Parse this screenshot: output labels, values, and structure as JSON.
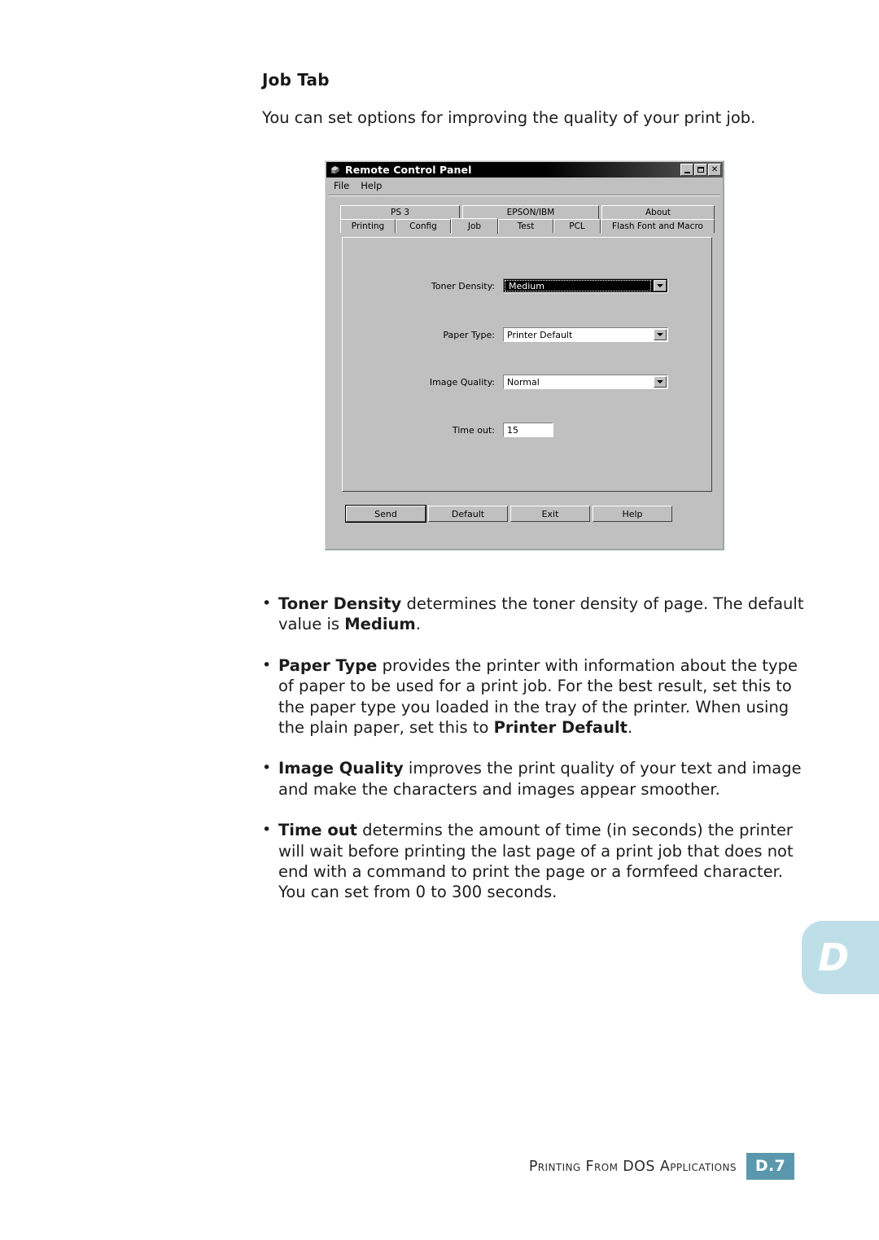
{
  "page": {
    "heading": "Job Tab",
    "intro": "You can set options for improving the quality of your print job.",
    "side_tab_letter": "D"
  },
  "bullets": [
    {
      "term": "Toner Density",
      "rest": " determines the toner density of page. The default value is ",
      "term2": "Medium",
      "tail": "."
    },
    {
      "term": "Paper Type",
      "rest": " provides the printer with information about the type of paper to be used for a print job. For the best result, set this to the paper type you loaded in the tray of the printer. When using the plain paper, set this to ",
      "term2": "Printer Default",
      "tail": "."
    },
    {
      "term": "Image Quality",
      "rest": " improves the print quality of your text and image and make the characters and images appear smoother.",
      "term2": "",
      "tail": ""
    },
    {
      "term": "Time out",
      "rest": " determins the amount of time (in seconds) the printer will wait before printing the last page of a print job that does not end with a command to print the page or a formfeed character. You can set from 0 to 300 seconds.",
      "term2": "",
      "tail": ""
    }
  ],
  "footer": {
    "text": "Printing From DOS Applications",
    "badge": "D.7"
  },
  "dialog": {
    "title": "Remote Control Panel",
    "menu": [
      "File",
      "Help"
    ],
    "titlebar_buttons": [
      "minimize",
      "maximize",
      "close"
    ],
    "tabs_row1": [
      "PS 3",
      "EPSON/IBM",
      "About"
    ],
    "tabs_row2": [
      "Printing",
      "Config",
      "Job",
      "Test",
      "PCL",
      "Flash Font and Macro"
    ],
    "selected_tab": "Job",
    "fields": [
      {
        "label": "Toner Density:",
        "value": "Medium",
        "type": "combo",
        "focused": true
      },
      {
        "label": "Paper Type:",
        "value": "Printer Default",
        "type": "combo",
        "focused": false
      },
      {
        "label": "Image Quality:",
        "value": "Normal",
        "type": "combo",
        "focused": false
      },
      {
        "label": "Time out:",
        "value": "15",
        "type": "text",
        "focused": false
      }
    ],
    "buttons": [
      "Send",
      "Default",
      "Exit",
      "Help"
    ],
    "default_button": "Send"
  },
  "colors": {
    "side_tab_bg": "#bfdfe8",
    "footer_badge_bg": "#5c98ad",
    "dialog_face": "#c0c0c0",
    "titlebar_start": "#000000"
  }
}
